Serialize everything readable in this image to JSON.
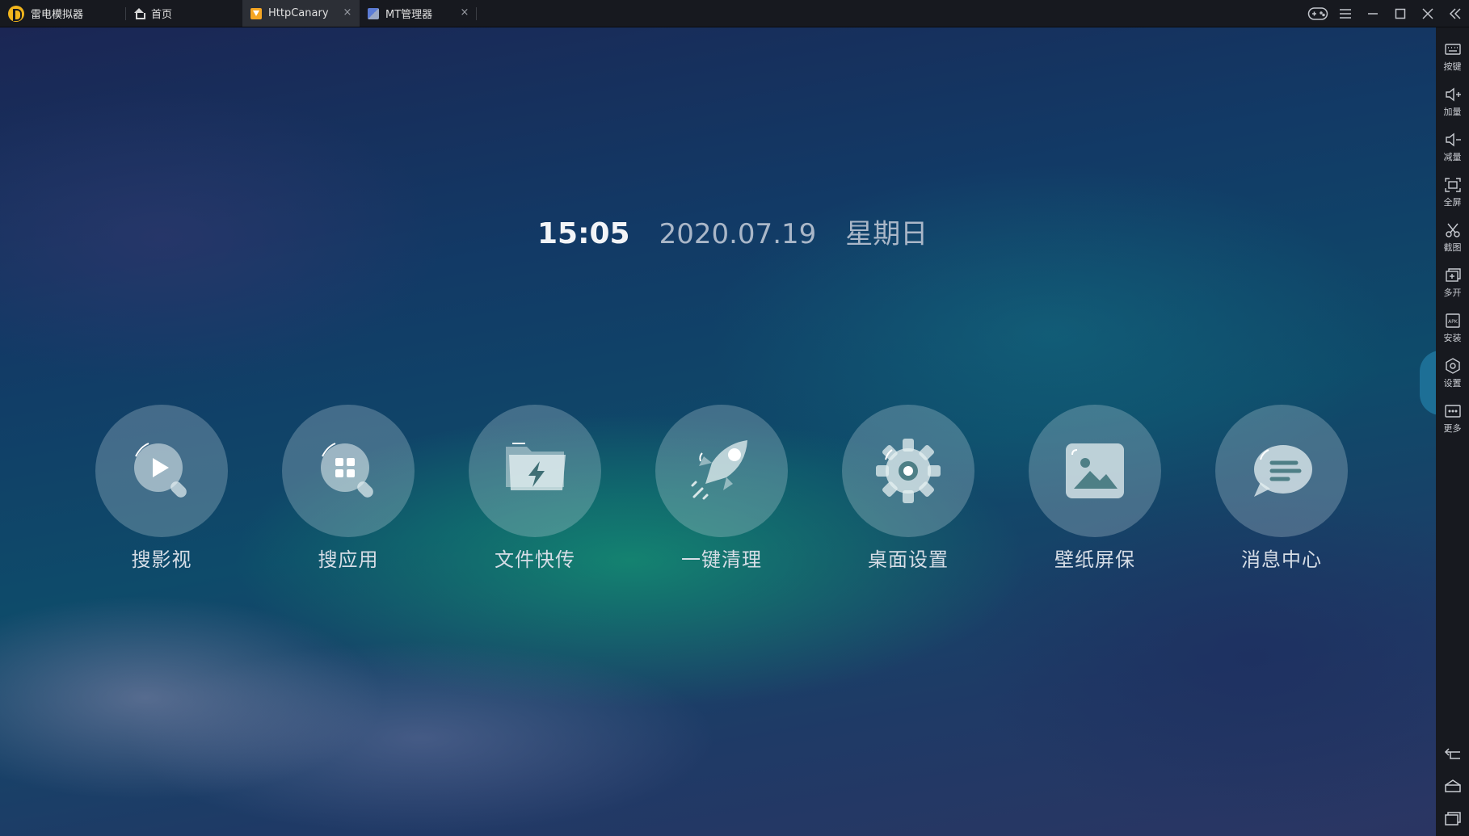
{
  "titlebar": {
    "app_name": "雷电模拟器",
    "tabs": [
      {
        "label": "首页",
        "icon": "home-icon",
        "closable": false,
        "active": false
      },
      {
        "label": "HttpCanary",
        "icon": "httpcanary-icon",
        "closable": true,
        "active": true
      },
      {
        "label": "MT管理器",
        "icon": "mt-manager-icon",
        "closable": true,
        "active": false
      }
    ],
    "close_glyph": "×",
    "controls": [
      "gamepad-icon",
      "menu-icon",
      "minimize-icon",
      "maximize-icon",
      "close-icon",
      "collapse-sidebar-icon"
    ]
  },
  "desktop": {
    "time": "15:05",
    "date": "2020.07.19",
    "weekday": "星期日",
    "apps": [
      {
        "label": "搜影视",
        "icon": "video-search-icon"
      },
      {
        "label": "搜应用",
        "icon": "app-search-icon"
      },
      {
        "label": "文件快传",
        "icon": "file-transfer-icon"
      },
      {
        "label": "一键清理",
        "icon": "rocket-clean-icon"
      },
      {
        "label": "桌面设置",
        "icon": "desktop-settings-icon"
      },
      {
        "label": "壁纸屏保",
        "icon": "wallpaper-icon"
      },
      {
        "label": "消息中心",
        "icon": "message-center-icon"
      }
    ]
  },
  "sidebar": {
    "items": [
      {
        "label": "按键",
        "icon": "keyboard-icon"
      },
      {
        "label": "加量",
        "icon": "volume-up-icon"
      },
      {
        "label": "减量",
        "icon": "volume-down-icon"
      },
      {
        "label": "全屏",
        "icon": "fullscreen-icon"
      },
      {
        "label": "截图",
        "icon": "scissors-icon"
      },
      {
        "label": "多开",
        "icon": "multi-instance-icon"
      },
      {
        "label": "安装",
        "icon": "apk-install-icon"
      },
      {
        "label": "设置",
        "icon": "settings-icon"
      },
      {
        "label": "更多",
        "icon": "more-icon"
      }
    ],
    "nav": [
      "back-icon",
      "home-icon",
      "recents-icon"
    ]
  },
  "colors": {
    "titlebar_bg": "#17191f",
    "active_tab_bg": "#2c2f36",
    "brand_yellow": "#f2b51c"
  }
}
